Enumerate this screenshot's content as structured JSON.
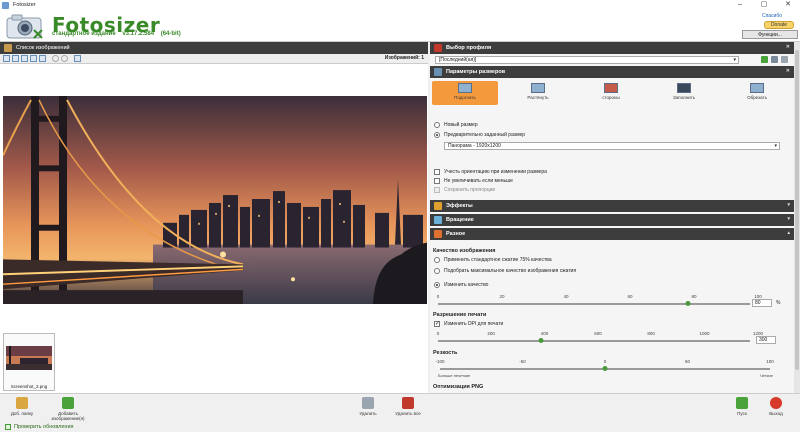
{
  "window": {
    "title": "Fotosizer",
    "controls": [
      "–",
      "▢",
      "✕"
    ]
  },
  "header": {
    "brand": "Fotosizer",
    "edition": "стандартное издание",
    "version": "v3.17.2.584",
    "bitness": "(64-bit)",
    "donate_link": "Спасибо",
    "donate_button": "Donate",
    "functions_button": "Функции..."
  },
  "left_panel": {
    "title": "Список изображений",
    "image_count": "Изображений: 1",
    "thumbnail_name": "Screenshot_2.png"
  },
  "profile": {
    "title": "Выбор профиля",
    "value": "[Последний(ая)]"
  },
  "resize": {
    "title": "Параметры размеров",
    "modes": [
      {
        "label": "Подогнать",
        "active": true
      },
      {
        "label": "Растянуть",
        "active": false
      },
      {
        "label": "стороны",
        "active": false
      },
      {
        "label": "Заполнить",
        "active": false
      },
      {
        "label": "Обрезать",
        "active": false
      }
    ],
    "new_size": "Новый размер",
    "preset_size": "Предварительно заданный размер",
    "preset_value": "Панорама - 1920x1200",
    "keep_orientation": "Учесть ориентацию при изменении размера",
    "no_enlarge": "Не увеличивать если меньше",
    "keep_proportions": "Сохранить пропорции"
  },
  "sections": {
    "effects": "Эффекты",
    "rotation": "Вращение",
    "misc": "Разное"
  },
  "quality": {
    "title": "Качество изображения",
    "opt_standard": "Применить стандартное сжатие 75% качества",
    "opt_match": "Подобрать максимальное качество изображения сжатия",
    "opt_change": "Изменить качество",
    "ticks": [
      "0",
      "20",
      "40",
      "60",
      "80",
      "100"
    ],
    "value": "80",
    "value_fraction": 0.8,
    "unit": "%"
  },
  "dpi": {
    "title": "Разрешение печати",
    "checkbox": "Изменить DPI для печати",
    "ticks": [
      "0",
      "200",
      "400",
      "600",
      "800",
      "1000",
      "1200"
    ],
    "value": "300",
    "value_fraction": 0.33
  },
  "sharpness": {
    "title": "Резкость",
    "ticks": [
      "-100",
      "-50",
      "0",
      "50",
      "100"
    ],
    "label_left": "Больше нечеткие",
    "label_right": "Четкие",
    "value_fraction": 0.5
  },
  "png": {
    "title": "Оптимизация PNG"
  },
  "bottom": {
    "add_file": "Доб. папку",
    "add_images": "Добавить изображение(я)",
    "clear": "Удалить",
    "clear_all": "Удалить все",
    "start": "Пуск",
    "exit": "Выход"
  },
  "status": {
    "update_check": "Проверить обновления"
  },
  "colors": {
    "accent_green": "#3a8a2a",
    "active_mode": "#f59a3c",
    "header_dark": "#3d3d3d"
  }
}
